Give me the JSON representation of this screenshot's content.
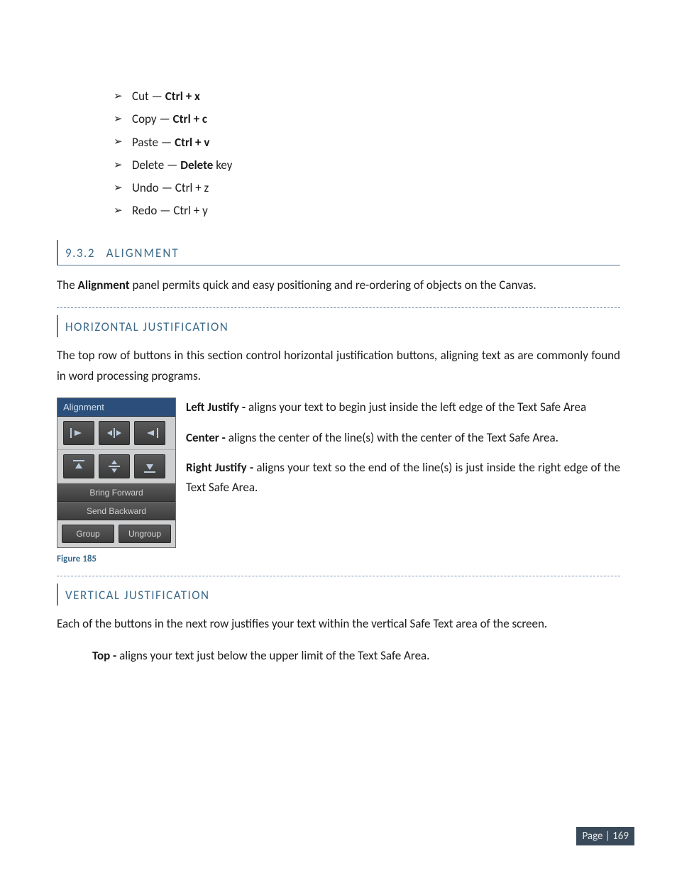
{
  "shortcuts": [
    {
      "label_pre": "Cut — ",
      "label_bold": "Ctrl + x",
      "label_post": ""
    },
    {
      "label_pre": "Copy — ",
      "label_bold": "Ctrl + c",
      "label_post": ""
    },
    {
      "label_pre": "Paste — ",
      "label_bold": "Ctrl + v",
      "label_post": ""
    },
    {
      "label_pre": "Delete — ",
      "label_bold": "Delete",
      "label_post": " key"
    },
    {
      "label_pre": "Undo — Ctrl + z",
      "label_bold": "",
      "label_post": ""
    },
    {
      "label_pre": "Redo — Ctrl + y",
      "label_bold": "",
      "label_post": ""
    }
  ],
  "section": {
    "number": "9.3.2",
    "title": "ALIGNMENT",
    "body": "The Alignment panel permits quick and easy positioning and re-ordering of objects on the Canvas."
  },
  "horizontal": {
    "title": "HORIZONTAL JUSTIFICATION",
    "intro": "The top row of buttons in this section control horizontal justification buttons, aligning text as are commonly found in word processing programs.",
    "items": {
      "left_label": "Left Justify - ",
      "left_text": "aligns your text to begin just inside the left edge of the Text Safe Area",
      "center_label": "Center - ",
      "center_text": "aligns the center of the line(s) with the center of the Text Safe Area.",
      "right_label": "Right Justify - ",
      "right_text": "aligns your text so the end of the line(s) is just inside the right edge of the Text Safe Area."
    }
  },
  "panel": {
    "title": "Alignment",
    "bring_forward": "Bring Forward",
    "send_backward": "Send Backward",
    "group": "Group",
    "ungroup": "Ungroup"
  },
  "figure": "Figure 185",
  "vertical": {
    "title": "VERTICAL JUSTIFICATION",
    "intro": "Each of the buttons in the next row justifies your text within the vertical Safe Text area of the screen.",
    "top_label": "Top - ",
    "top_text": "aligns your text just below the upper limit of the Text Safe Area."
  },
  "footer": "Page | 169"
}
